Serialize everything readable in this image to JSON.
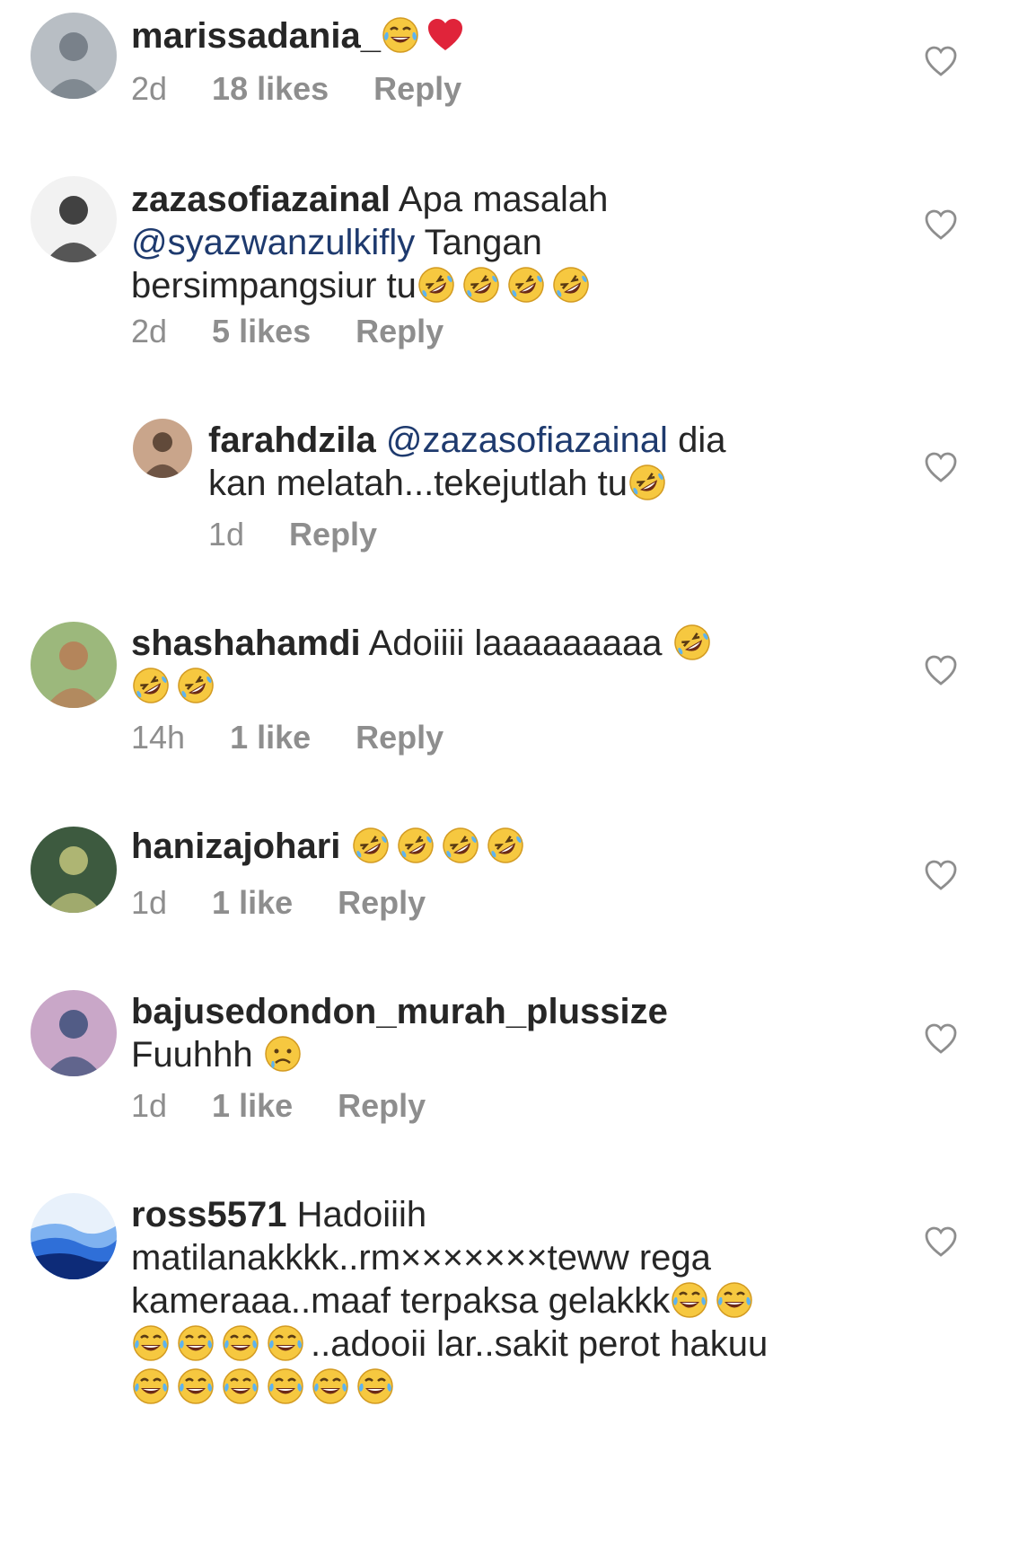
{
  "comments": [
    {
      "user": "marissadania_",
      "segments": [
        {
          "t": "emoji",
          "e": "joy"
        },
        {
          "t": "emoji",
          "e": "heart"
        }
      ],
      "time": "2d",
      "likes": "18 likes",
      "reply": "Reply",
      "avatar": "avatar-photo"
    },
    {
      "user": "zazasofiazainal",
      "segments": [
        {
          "t": "text",
          "v": " Apa masalah "
        },
        {
          "t": "mention",
          "v": "@syazwanzulkifly"
        },
        {
          "t": "text",
          "v": " Tangan bersimpangsiur tu"
        },
        {
          "t": "emoji",
          "e": "rofl"
        },
        {
          "t": "emoji",
          "e": "rofl"
        },
        {
          "t": "emoji",
          "e": "rofl"
        },
        {
          "t": "emoji",
          "e": "rofl"
        }
      ],
      "time": "2d",
      "likes": "5 likes",
      "reply": "Reply",
      "avatar": "avatar-photo"
    },
    {
      "user": "farahdzila",
      "segments": [
        {
          "t": "text",
          "v": " "
        },
        {
          "t": "mention",
          "v": "@zazasofiazainal"
        },
        {
          "t": "text",
          "v": " dia kan melatah...tekejutlah tu"
        },
        {
          "t": "emoji",
          "e": "rofl"
        }
      ],
      "time": "1d",
      "likes": "",
      "reply": "Reply",
      "avatar": "avatar-photo",
      "nested": true
    },
    {
      "user": "shashahamdi",
      "segments": [
        {
          "t": "text",
          "v": " Adoiiii laaaaaaaaa "
        },
        {
          "t": "emoji",
          "e": "rofl"
        },
        {
          "t": "emoji",
          "e": "rofl"
        },
        {
          "t": "emoji",
          "e": "rofl"
        }
      ],
      "time": "14h",
      "likes": "1 like",
      "reply": "Reply",
      "avatar": "avatar-photo"
    },
    {
      "user": "hanizajohari",
      "segments": [
        {
          "t": "text",
          "v": " "
        },
        {
          "t": "emoji",
          "e": "rofl"
        },
        {
          "t": "emoji",
          "e": "rofl"
        },
        {
          "t": "emoji",
          "e": "rofl"
        },
        {
          "t": "emoji",
          "e": "rofl"
        }
      ],
      "time": "1d",
      "likes": "1 like",
      "reply": "Reply",
      "avatar": "avatar-photo"
    },
    {
      "user": "bajusedondon_murah_plussize",
      "segments": [
        {
          "t": "text",
          "v": " Fuuhhh "
        },
        {
          "t": "emoji",
          "e": "sad"
        }
      ],
      "time": "1d",
      "likes": "1 like",
      "reply": "Reply",
      "avatar": "avatar-photo"
    },
    {
      "user": "ross5571",
      "segments": [
        {
          "t": "text",
          "v": " Hadoiiih matilanakkkk..rm×××××××teww rega kameraaa..maaf terpaksa gelakkk"
        },
        {
          "t": "emoji",
          "e": "joy"
        },
        {
          "t": "emoji",
          "e": "joy"
        },
        {
          "t": "emoji",
          "e": "joy"
        },
        {
          "t": "emoji",
          "e": "joy"
        },
        {
          "t": "emoji",
          "e": "joy"
        },
        {
          "t": "emoji",
          "e": "joy"
        },
        {
          "t": "text",
          "v": "..adooii lar..sakit perot hakuu"
        },
        {
          "t": "emoji",
          "e": "joy"
        },
        {
          "t": "emoji",
          "e": "joy"
        },
        {
          "t": "emoji",
          "e": "joy"
        },
        {
          "t": "emoji",
          "e": "joy"
        },
        {
          "t": "emoji",
          "e": "joy"
        },
        {
          "t": "emoji",
          "e": "joy"
        }
      ],
      "time": "",
      "likes": "",
      "reply": "",
      "avatar": "avatar-photo"
    }
  ],
  "colors": {
    "username": "#262626",
    "mention": "#1e3a6e",
    "meta": "#8e8e8e",
    "heart": "#8e8e8e"
  }
}
